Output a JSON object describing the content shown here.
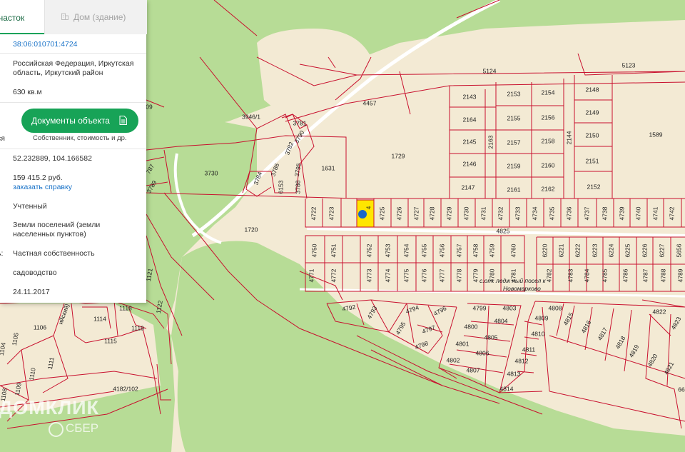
{
  "tabs": {
    "plot": "участок",
    "building": "Дом (здание)"
  },
  "info": {
    "cadastral_number": "38:06:010701:4724",
    "address_line1": "Российская Федерация, Иркутская",
    "address_line2": "область, Иркутский район",
    "area": "630 кв.м",
    "docs_button": "Документы объекта",
    "docs_note": "Собственник, стоимость и др.",
    "docs_label_cut": "ся",
    "coords": "52.232889, 104.166582",
    "cost": "159 415.2 руб.",
    "order_link": "заказать справку",
    "status": "Учтенный",
    "category_line1": "Земли поселений (земли",
    "category_line2": "населенных пунктов)",
    "ownership_label_cut": "ь:",
    "ownership": "Частная собственность",
    "use": "садоводство",
    "date": "24.11.2017"
  },
  "map": {
    "settlement_line1": "с.от. ледж ный посел к",
    "settlement_line2": "Новомарково",
    "labels_top": [
      "5124",
      "5123",
      "4457",
      "3946/1",
      "3781",
      "3790",
      "3782",
      "3795",
      "3786",
      "3784",
      "3788",
      "6153",
      "3730",
      "1631",
      "1729",
      "1589",
      "1720",
      "4825",
      "3789",
      "787",
      "09"
    ],
    "labels_blocks": [
      "2143",
      "2153",
      "2154",
      "2148",
      "2164",
      "2155",
      "2156",
      "2149",
      "2145",
      "2163",
      "2157",
      "2158",
      "2144",
      "2150",
      "2146",
      "2159",
      "2160",
      "2151",
      "2147",
      "2161",
      "2162",
      "2152"
    ],
    "labels_row1": [
      "4722",
      "4723",
      "4725",
      "4726",
      "4727",
      "4728",
      "4729",
      "4730",
      "4731",
      "4732",
      "4733",
      "4734",
      "4735",
      "4736",
      "4737",
      "4738",
      "4739",
      "4740",
      "4741",
      "4742"
    ],
    "labels_row2": [
      "4750",
      "4751",
      "4752",
      "4753",
      "4754",
      "4755",
      "4756",
      "4757",
      "4758",
      "4759",
      "4760",
      "6220",
      "6221",
      "6222",
      "6223",
      "6224",
      "6225",
      "6226",
      "6227",
      "5656"
    ],
    "labels_row3": [
      "4771",
      "4772",
      "4773",
      "4774",
      "4775",
      "4776",
      "4777",
      "4778",
      "4779",
      "4780",
      "4781",
      "4782",
      "4783",
      "4784",
      "4785",
      "4786",
      "4787",
      "4788",
      "4789"
    ],
    "labels_lower": [
      "4792",
      "4793",
      "4794",
      "4796",
      "4795",
      "4797",
      "4798",
      "4799",
      "4803",
      "4800",
      "4804",
      "4805",
      "4801",
      "4806",
      "4802",
      "4807",
      "4808",
      "4809",
      "4810",
      "4811",
      "4812",
      "4813",
      "4814",
      "4815",
      "4816",
      "4817",
      "4818",
      "4819",
      "4820",
      "4821",
      "4822",
      "4823",
      "66"
    ],
    "labels_left": [
      "1121",
      "1122",
      "1118",
      "1114",
      "1119",
      "1115",
      "1106",
      "1105",
      "1110",
      "1111",
      "1104",
      "1109",
      "1108",
      "4182/102",
      "ийский)"
    ],
    "selected_label": "4"
  },
  "watermark": {
    "brand": "ДОМКЛИК",
    "partner": "СБЕР"
  },
  "colors": {
    "land": "#f3ead4",
    "forest": "#b7dc96",
    "parcel_line": "#c8102e",
    "selected": "#ffe600",
    "accent": "#17a357",
    "link": "#1a73c8"
  }
}
